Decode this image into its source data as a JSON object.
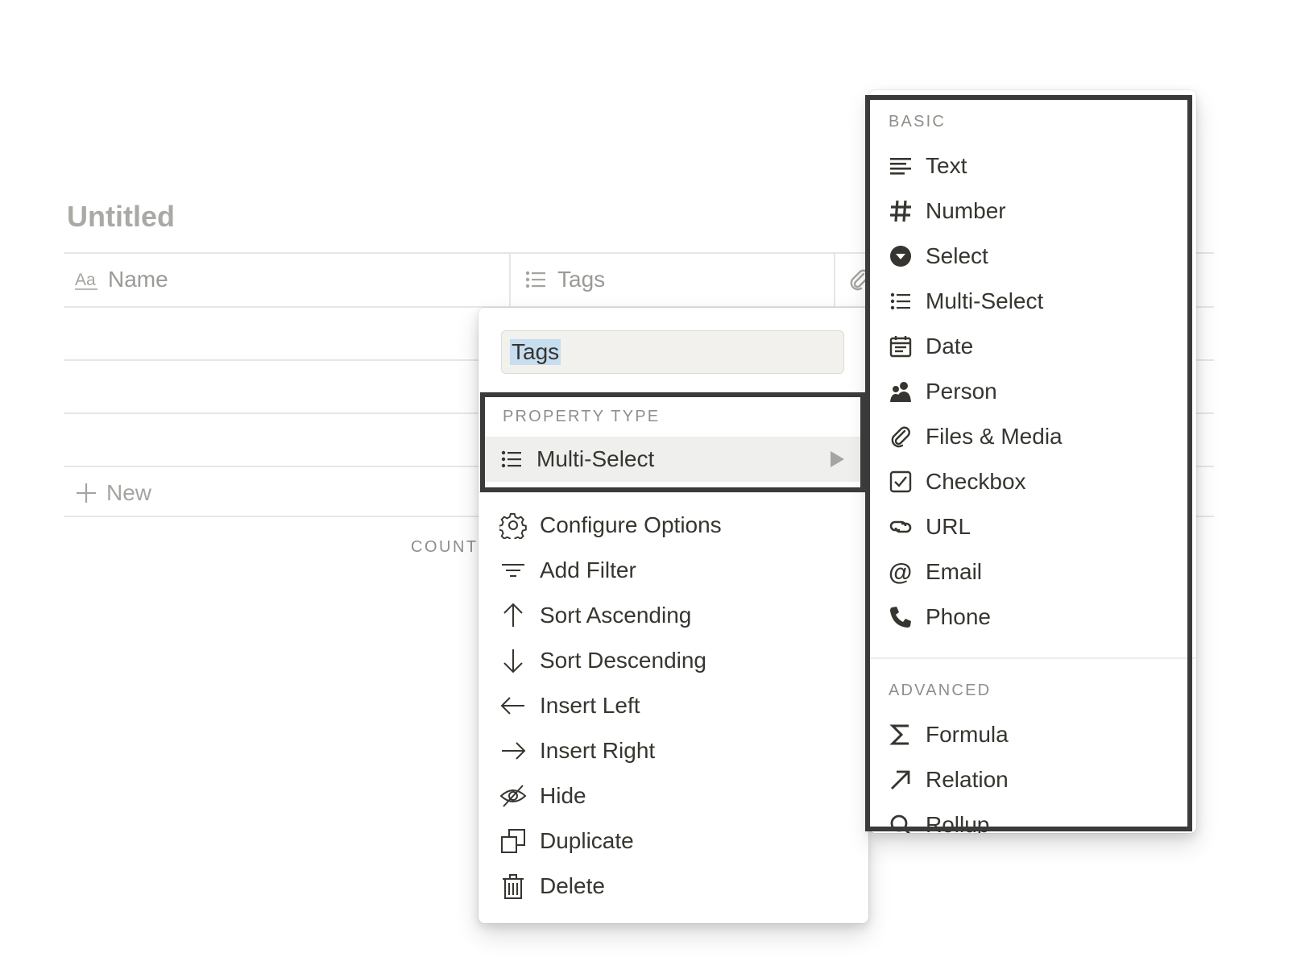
{
  "page": {
    "title": "Untitled"
  },
  "table": {
    "columns": [
      {
        "name": "Name",
        "icon": "text-aa-icon"
      },
      {
        "name": "Tags",
        "icon": "multi-select-list-icon"
      },
      {
        "name": "",
        "icon": "paperclip-icon"
      }
    ],
    "new_row_label": "New",
    "count_label": "COUNT"
  },
  "property_menu": {
    "name_value": "Tags",
    "section_label": "PROPERTY TYPE",
    "current_type": {
      "label": "Multi-Select",
      "icon": "multi-select-list-icon"
    },
    "actions": [
      {
        "label": "Configure Options",
        "icon": "gear-icon"
      },
      {
        "label": "Add Filter",
        "icon": "filter-icon"
      },
      {
        "label": "Sort Ascending",
        "icon": "arrow-up-icon"
      },
      {
        "label": "Sort Descending",
        "icon": "arrow-down-icon"
      },
      {
        "label": "Insert Left",
        "icon": "arrow-left-icon"
      },
      {
        "label": "Insert Right",
        "icon": "arrow-right-icon"
      },
      {
        "label": "Hide",
        "icon": "eye-off-icon"
      },
      {
        "label": "Duplicate",
        "icon": "duplicate-icon"
      },
      {
        "label": "Delete",
        "icon": "trash-icon"
      }
    ]
  },
  "type_menu": {
    "basic_label": "BASIC",
    "basic": [
      {
        "label": "Text",
        "icon": "text-lines-icon"
      },
      {
        "label": "Number",
        "icon": "hash-icon"
      },
      {
        "label": "Select",
        "icon": "select-circle-icon"
      },
      {
        "label": "Multi-Select",
        "icon": "multi-select-list-icon"
      },
      {
        "label": "Date",
        "icon": "calendar-icon"
      },
      {
        "label": "Person",
        "icon": "person-icon"
      },
      {
        "label": "Files & Media",
        "icon": "paperclip-icon"
      },
      {
        "label": "Checkbox",
        "icon": "checkbox-icon"
      },
      {
        "label": "URL",
        "icon": "link-icon"
      },
      {
        "label": "Email",
        "icon": "at-icon"
      },
      {
        "label": "Phone",
        "icon": "phone-icon"
      }
    ],
    "advanced_label": "ADVANCED",
    "advanced": [
      {
        "label": "Formula",
        "icon": "sigma-icon"
      },
      {
        "label": "Relation",
        "icon": "arrow-up-right-icon"
      },
      {
        "label": "Rollup",
        "icon": "search-icon"
      }
    ]
  },
  "colors": {
    "annotation_border": "#3a3a3a",
    "selected_row_bg": "#efefed",
    "text_selection": "#c7ddf0",
    "muted_text": "#9b9a97"
  }
}
